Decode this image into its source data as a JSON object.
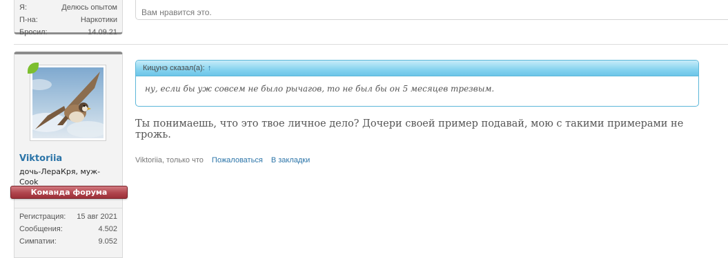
{
  "previous_post": {
    "stats": [
      {
        "label": "Я:",
        "value": "Делюсь опытом"
      },
      {
        "label": "П-на:",
        "value": "Наркотики"
      },
      {
        "label": "Бросил:",
        "value": "14.09.21"
      }
    ],
    "reply_text": "Вам нравится это."
  },
  "user": {
    "username": "Viktoriia",
    "title": "дочь-ЛераКря, муж-Cook",
    "badge": "Команда форума",
    "stats": [
      {
        "label": "Регистрация:",
        "value": "15 авг 2021"
      },
      {
        "label": "Сообщения:",
        "value": "4.502"
      },
      {
        "label": "Симпатии:",
        "value": "9.052"
      }
    ]
  },
  "post": {
    "quote": {
      "author_line": "Кицунэ сказал(а):",
      "up_arrow": "↑",
      "text": "ну, если бы уж совсем не было рычагов, то не был бы он 5 месяцев трезвым."
    },
    "text": "Ты понимаешь, что это твое личное дело? Дочери своей пример подавай, мою с такими примерами не трожь.",
    "meta": {
      "author_time": "Viktoriia, только что",
      "report_label": "Пожаловаться",
      "bookmark_label": "В закладки"
    }
  },
  "colors": {
    "accent": "#2b74a8",
    "quote_border": "#5bb6d8",
    "badge": "#a83c44"
  }
}
